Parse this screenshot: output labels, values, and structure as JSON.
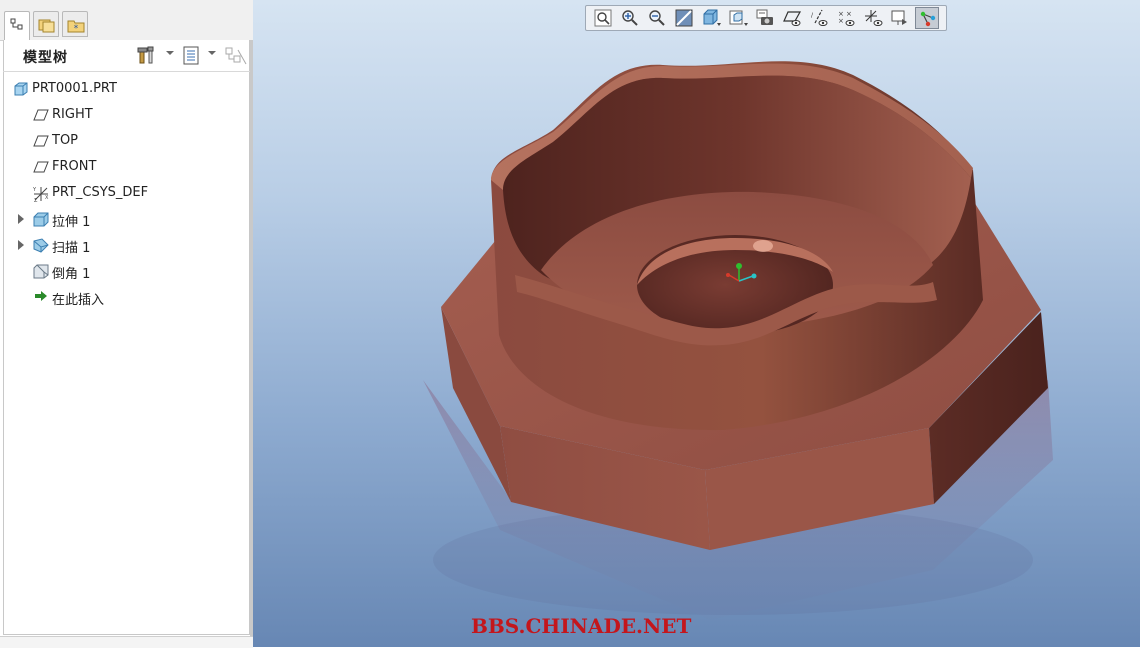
{
  "navigator": {
    "tabs": [
      {
        "name": "model-tree",
        "active": true
      },
      {
        "name": "folder-browser",
        "active": false
      },
      {
        "name": "favorites",
        "active": false
      }
    ]
  },
  "model_tree": {
    "title": "模型树",
    "items": [
      {
        "label": "PRT0001.PRT",
        "icon": "part-icon",
        "expandable": false,
        "indent": 0
      },
      {
        "label": "RIGHT",
        "icon": "datum-plane-icon",
        "expandable": false,
        "indent": 1
      },
      {
        "label": "TOP",
        "icon": "datum-plane-icon",
        "expandable": false,
        "indent": 1
      },
      {
        "label": "FRONT",
        "icon": "datum-plane-icon",
        "expandable": false,
        "indent": 1
      },
      {
        "label": "PRT_CSYS_DEF",
        "icon": "coordinate-system-icon",
        "expandable": false,
        "indent": 1
      },
      {
        "label": "拉伸 1",
        "icon": "extrude-icon",
        "expandable": true,
        "indent": 1
      },
      {
        "label": "扫描 1",
        "icon": "sweep-icon",
        "expandable": true,
        "indent": 1
      },
      {
        "label": "倒角 1",
        "icon": "chamfer-icon",
        "expandable": false,
        "indent": 1
      },
      {
        "label": "在此插入",
        "icon": "insert-here-arrow-icon",
        "expandable": false,
        "indent": 1
      }
    ]
  },
  "graphics_toolbar": {
    "buttons": [
      "refit-icon",
      "zoom-in-icon",
      "zoom-out-icon",
      "repaint-icon",
      "display-style-icon",
      "saved-orientations-icon",
      "view-manager-icon",
      "plane-display-icon",
      "axis-display-icon",
      "point-display-icon",
      "csys-display-icon",
      "spin-center-icon",
      "annotation-display-icon"
    ],
    "pressed": "annotation-display-icon"
  },
  "colors": {
    "model_base": "#9a5648",
    "model_dark": "#5a2a24",
    "model_light": "#b46a5a",
    "viewport_top": "#d6e4f2",
    "viewport_bottom": "#6787b4",
    "watermark": "#c4161c"
  },
  "watermark": "BBS.CHINADE.NET"
}
